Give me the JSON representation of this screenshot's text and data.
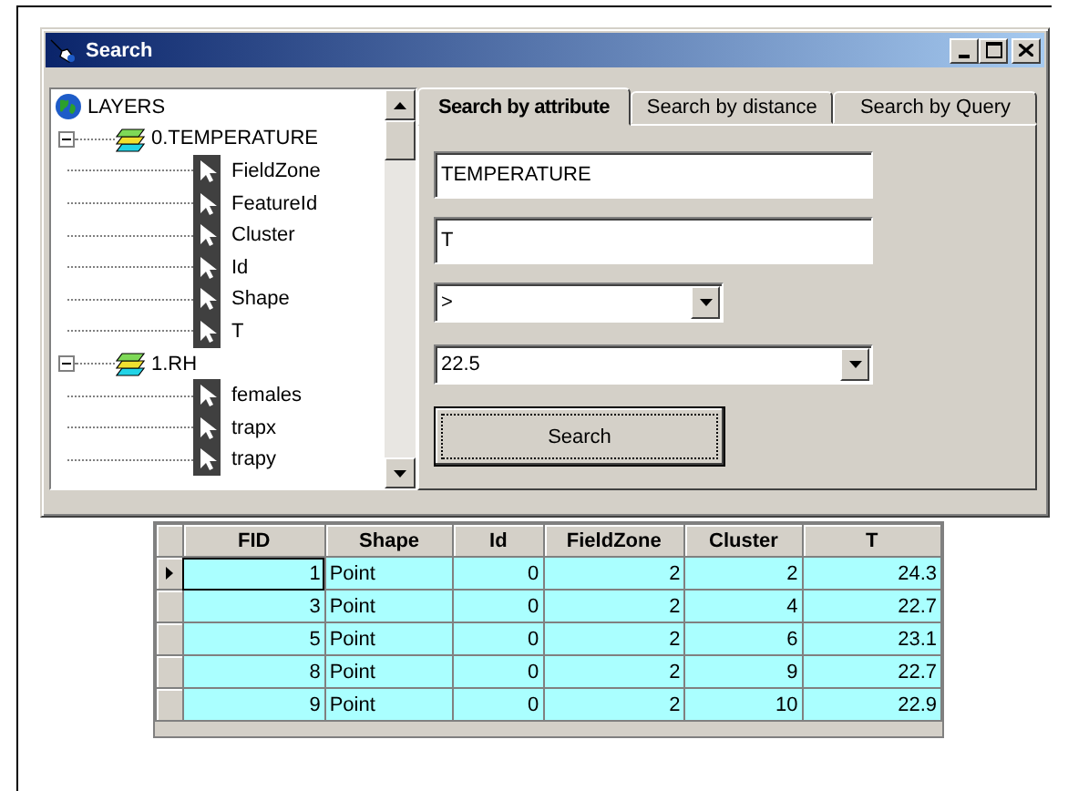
{
  "window": {
    "title": "Search"
  },
  "tree": {
    "root": {
      "label": "LAYERS"
    },
    "layers": [
      {
        "label": "0.TEMPERATURE",
        "expanded": true,
        "fields": [
          "FieldZone",
          "FeatureId",
          "Cluster",
          "Id",
          "Shape",
          "T"
        ]
      },
      {
        "label": "1.RH",
        "expanded": true,
        "fields": [
          "females",
          "trapx",
          "trapy"
        ]
      }
    ]
  },
  "tabs": [
    {
      "label": "Search by attribute",
      "selected": true
    },
    {
      "label": "Search by distance",
      "selected": false
    },
    {
      "label": "Search by Query",
      "selected": false
    }
  ],
  "form": {
    "layer_field": {
      "value": "TEMPERATURE"
    },
    "attribute_field": {
      "value": "T"
    },
    "operator_dropdown": {
      "value": ">"
    },
    "value_combo": {
      "value": "22.5"
    },
    "search_button": "Search"
  },
  "table": {
    "columns": [
      "FID",
      "Shape",
      "Id",
      "FieldZone",
      "Cluster",
      "T"
    ],
    "rows": [
      {
        "cells": [
          "1",
          "Point",
          "0",
          "2",
          "2",
          "24.3"
        ],
        "selected": true
      },
      {
        "cells": [
          "3",
          "Point",
          "0",
          "2",
          "4",
          "22.7"
        ],
        "selected": false
      },
      {
        "cells": [
          "5",
          "Point",
          "0",
          "2",
          "6",
          "23.1"
        ],
        "selected": false
      },
      {
        "cells": [
          "8",
          "Point",
          "0",
          "2",
          "9",
          "22.7"
        ],
        "selected": false
      },
      {
        "cells": [
          "9",
          "Point",
          "0",
          "2",
          "10",
          "22.9"
        ],
        "selected": false
      }
    ]
  }
}
